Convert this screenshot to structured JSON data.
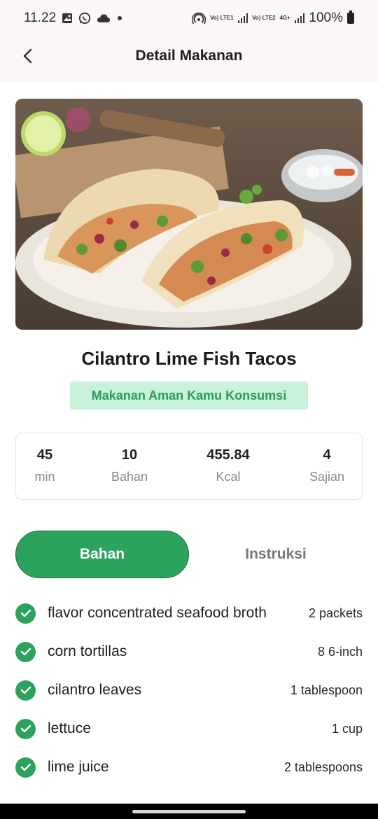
{
  "status_bar": {
    "time": "11.22",
    "battery": "100%",
    "net1": "Vo) LTE1",
    "net2": "Vo) LTE2",
    "net3": "4G+"
  },
  "app_bar": {
    "title": "Detail Makanan"
  },
  "food": {
    "title": "Cilantro Lime Fish Tacos",
    "safety_badge": "Makanan Aman Kamu Konsumsi"
  },
  "stats": [
    {
      "value": "45",
      "label": "min"
    },
    {
      "value": "10",
      "label": "Bahan"
    },
    {
      "value": "455.84",
      "label": "Kcal"
    },
    {
      "value": "4",
      "label": "Sajian"
    }
  ],
  "tabs": {
    "ingredients": "Bahan",
    "instructions": "Instruksi",
    "active": "Bahan"
  },
  "ingredients": [
    {
      "name": "flavor concentrated seafood broth",
      "qty": "2 packets"
    },
    {
      "name": "corn tortillas",
      "qty": "8 6-inch"
    },
    {
      "name": "cilantro leaves",
      "qty": "1 tablespoon"
    },
    {
      "name": "lettuce",
      "qty": "1 cup"
    },
    {
      "name": "lime juice",
      "qty": "2 tablespoons"
    }
  ],
  "colors": {
    "accent": "#2ba35d",
    "badge_bg": "#c8f2d9",
    "app_bar_bg": "#fcf6fb"
  }
}
